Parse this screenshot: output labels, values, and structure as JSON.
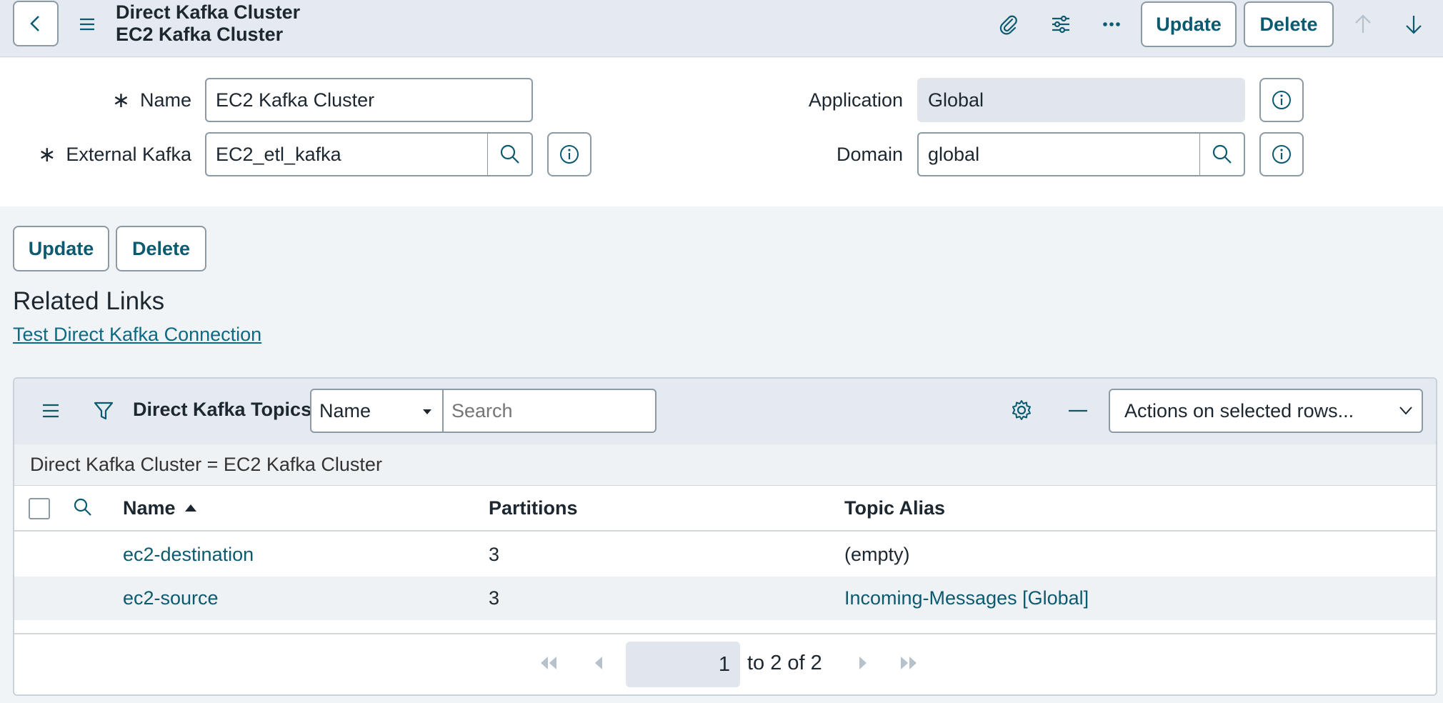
{
  "header": {
    "title_line1": "Direct Kafka Cluster",
    "title_line2": "EC2 Kafka Cluster",
    "update_label": "Update",
    "delete_label": "Delete"
  },
  "form": {
    "name_label": "Name",
    "name_value": "EC2 Kafka Cluster",
    "external_kafka_label": "External Kafka",
    "external_kafka_value": "EC2_etl_kafka",
    "application_label": "Application",
    "application_value": "Global",
    "domain_label": "Domain",
    "domain_value": "global",
    "required_mark": "∗"
  },
  "actions": {
    "update_label": "Update",
    "delete_label": "Delete"
  },
  "related": {
    "title": "Related Links",
    "link": "Test Direct Kafka Connection"
  },
  "list": {
    "title": "Direct Kafka Topics",
    "search_field_selected": "Name",
    "search_placeholder": "Search",
    "actions_selected": "Actions on selected rows...",
    "filter_text": "Direct Kafka Cluster = EC2 Kafka Cluster",
    "columns": [
      "Name",
      "Partitions",
      "Topic Alias"
    ],
    "rows": [
      {
        "name": "ec2-destination",
        "partitions": "3",
        "alias": "(empty)"
      },
      {
        "name": "ec2-source",
        "partitions": "3",
        "alias": "Incoming-Messages [Global]"
      }
    ],
    "pagination": {
      "current": "1",
      "range_text": "to 2 of 2"
    }
  },
  "colors": {
    "header_bg": "#e4eaef",
    "link": "#0c5a70",
    "border": "#8c9aa6"
  }
}
